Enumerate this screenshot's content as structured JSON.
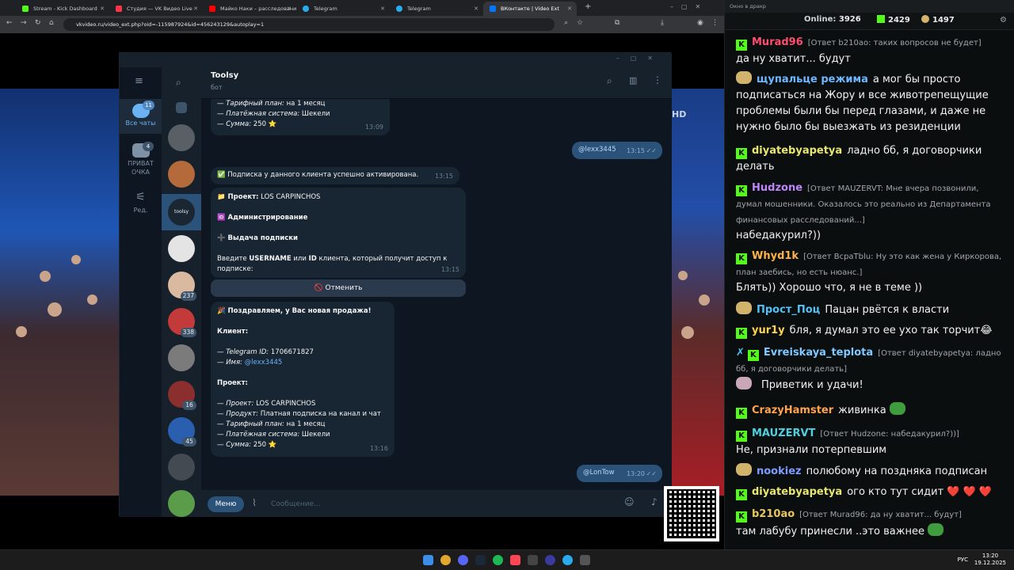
{
  "browser": {
    "tabs": [
      {
        "title": "Stream - Kick Dashboard",
        "color": "#53fc18"
      },
      {
        "title": "Студия — VK Видео Live",
        "color": "#ff3347"
      },
      {
        "title": "Майко Наки – расследование",
        "color": "#ff0000"
      },
      {
        "title": "Telegram",
        "color": "#2aabee"
      },
      {
        "title": "Telegram",
        "color": "#2aabee"
      },
      {
        "title": "ВКонтакте | Video Ext",
        "color": "#0077ff"
      }
    ],
    "new_tab": "+",
    "url": "vkvideo.ru/video_ext.php?oid=-115987924&id=456243129&autoplay=1"
  },
  "video": {
    "hd_label": "HD"
  },
  "telegram": {
    "folders": [
      {
        "label": "Все чаты",
        "badge": "11"
      },
      {
        "label": "ПРИВАТ ОЧКА",
        "badge": "4"
      },
      {
        "label": "Ред.",
        "badge": ""
      }
    ],
    "chat_list_badges": [
      "237",
      "338",
      "16",
      "45"
    ],
    "header": {
      "title": "Toolsy",
      "subtitle": "бот"
    },
    "messages": {
      "m1": {
        "line1_label": "— Тарифный план:",
        "line1_value": " на 1 месяц",
        "line2_label": "— Платёжная система:",
        "line2_value": " Шекели",
        "line3_label": "— Сумма:",
        "line3_value": " 250 ⭐",
        "time": "13:09"
      },
      "out1": {
        "text": "@lexx3445",
        "time": "13:15"
      },
      "m2": {
        "text": "✅ Подписка у данного клиента успешно активирована.",
        "time": "13:15"
      },
      "m3": {
        "project_label": "📁 Проект:",
        "project_value": " LOS CARPINCHOS",
        "admin": "🆔 Администрирование",
        "issue": "➕ Выдача подписки",
        "prompt_pre": "Введите ",
        "prompt_user": "USERNAME",
        "prompt_mid": " или ",
        "prompt_id": "ID",
        "prompt_post": " клиента, который получит доступ к подписке:",
        "time": "13:15",
        "cancel": "🚫 Отменить"
      },
      "m4": {
        "title": "🎉 Поздравляем, у Вас новая продажа!",
        "client_label": "Клиент:",
        "tg_label": "— Telegram ID:",
        "tg_value": " 1706671827",
        "name_label": "— Имя:",
        "name_value": "@lexx3445",
        "project_label": "Проект:",
        "proj_label": "— Проект:",
        "proj_value": " LOS CARPINCHOS",
        "prod_label": "— Продукт:",
        "prod_value": " Платная подписка на канал и чат",
        "plan_label": "— Тарифный план:",
        "plan_value": " на 1 месяц",
        "pay_label": "— Платёжная система:",
        "pay_value": " Шекели",
        "sum_label": "— Сумма:",
        "sum_value": " 250 ⭐",
        "time": "13:16"
      },
      "out2": {
        "text": "@LonTow",
        "time": "13:20"
      }
    },
    "composer": {
      "menu": "Меню",
      "placeholder": "Сообщение..."
    }
  },
  "kick": {
    "window_title": "Окно в дракр",
    "stats": {
      "online_label": "Online:",
      "online_value": "3926",
      "followers": "2429",
      "subs": "1497"
    },
    "messages": [
      {
        "user": "Murad96",
        "color": "#ff4d6d",
        "badge": "kick",
        "reply": "[Ответ b210ao: таких вопросов не будет]",
        "text": "да ну хватит... будут"
      },
      {
        "user": "щупальце режима",
        "color": "#6fb7ff",
        "badge": "emote",
        "reply": "",
        "text": "а мог бы просто подписаться на Жору и все животрепещущие проблемы были бы перед глазами, и даже не нужно было бы выезжать из резиденции"
      },
      {
        "user": "diyatebyapetya",
        "color": "#e8e870",
        "badge": "kick",
        "reply": "",
        "text": "ладно бб, я договорчики делать"
      },
      {
        "user": "Hudzone",
        "color": "#c084fc",
        "badge": "kick",
        "reply": "[Ответ MAUZERVT: Мне вчера позвонили, думал мошенники. Оказалось это реально из Департамента финансовых расследований...]",
        "text": "набедакурил?))"
      },
      {
        "user": "Whyd1k",
        "color": "#ffb347",
        "badge": "kick",
        "reply": "[Ответ ВсраТblu: Ну это как жена у Киркорова, план заебись, но есть нюанс.]",
        "text": "Блять)) Хорошо что, я не в теме ))"
      },
      {
        "user": "Прост_Поц",
        "color": "#4fc3f7",
        "badge": "emote",
        "reply": "",
        "text": "Пацан рвётся к власти"
      },
      {
        "user": "yur1y",
        "color": "#ffd54f",
        "badge": "kick",
        "reply": "",
        "text": "бля, я думал это ее ухо так торчит😂"
      },
      {
        "user": "Evreiskaya_teplota",
        "color": "#7ec8ff",
        "badge": "kick",
        "reply": "[Ответ diyatebyapetya: ладно бб, я договорчики делать]",
        "text": ""
      },
      {
        "user": "",
        "color": "#ffffff",
        "badge": "emote",
        "reply": "",
        "text": "Приветик и удачи!"
      },
      {
        "user": "CrazyHamster",
        "color": "#ffa34d",
        "badge": "kick",
        "reply": "",
        "text": "живинка"
      },
      {
        "user": "MAUZERVT",
        "color": "#4dd0e1",
        "badge": "kick",
        "reply": "[Ответ Hudzone: набедакурил?))]",
        "text": "Не, признали потерпевшим"
      },
      {
        "user": "nookiez",
        "color": "#7e9cff",
        "badge": "emote",
        "reply": "",
        "text": "полюбому на поздняка подписан"
      },
      {
        "user": "diyatebyapetya",
        "color": "#e8e870",
        "badge": "kick",
        "reply": "",
        "text": "ого кто тут сидит ❤️ ❤️ ❤️"
      },
      {
        "user": "b210ao",
        "color": "#e8c75a",
        "badge": "kick",
        "reply": "[Ответ Murad96: да ну хватит... будут]",
        "text": "там лабубу принесли ..это важнее"
      }
    ]
  },
  "taskbar": {
    "lang": "РУС",
    "time": "13:20",
    "date": "19.12.2025"
  }
}
